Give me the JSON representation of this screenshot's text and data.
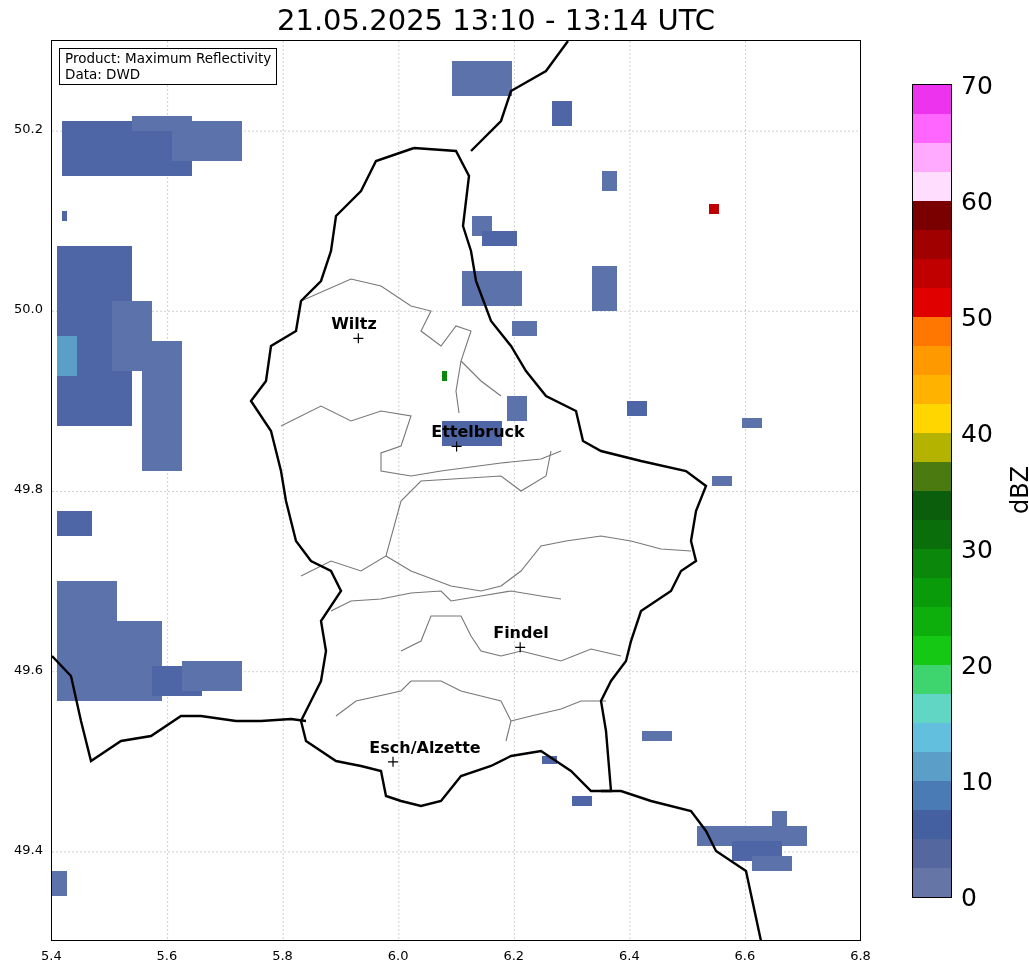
{
  "title": "21.05.2025 13:10 - 13:14 UTC",
  "info_box": {
    "lines": [
      "Product: Maximum Reflectivity",
      "Data: DWD"
    ]
  },
  "y_ticks": [
    "50.2",
    "50.0",
    "49.8",
    "49.6",
    "49.4"
  ],
  "x_ticks": [
    "5.4",
    "5.6",
    "5.8",
    "6.0",
    "6.2",
    "6.4",
    "6.6",
    "6.8"
  ],
  "cities": [
    {
      "name": "Wiltz"
    },
    {
      "name": "Ettelbruck"
    },
    {
      "name": "Findel"
    },
    {
      "name": "Esch/Alzette"
    }
  ],
  "colorbar": {
    "label": "dBZ",
    "ticks": [
      "70",
      "60",
      "50",
      "40",
      "30",
      "20",
      "10",
      "0"
    ],
    "segments": [
      {
        "color": "#ee33ee"
      },
      {
        "color": "#ff66ff"
      },
      {
        "color": "#ffaaff"
      },
      {
        "color": "#ffddff"
      },
      {
        "color": "#7a0000"
      },
      {
        "color": "#a00000"
      },
      {
        "color": "#c00000"
      },
      {
        "color": "#e00000"
      },
      {
        "color": "#ff7700"
      },
      {
        "color": "#ff9900"
      },
      {
        "color": "#ffb300"
      },
      {
        "color": "#ffd600"
      },
      {
        "color": "#b3b300"
      },
      {
        "color": "#4b7a10"
      },
      {
        "color": "#0b5e0b"
      },
      {
        "color": "#0a6e0a"
      },
      {
        "color": "#0b880b"
      },
      {
        "color": "#0a9b0a"
      },
      {
        "color": "#0caf0c"
      },
      {
        "color": "#14c814"
      },
      {
        "color": "#3ed46e"
      },
      {
        "color": "#62d6c4"
      },
      {
        "color": "#62c0de"
      },
      {
        "color": "#5b9fc8"
      },
      {
        "color": "#4b7bb5"
      },
      {
        "color": "#4460a0"
      },
      {
        "color": "#54679e"
      },
      {
        "color": "#6575a6"
      }
    ]
  }
}
